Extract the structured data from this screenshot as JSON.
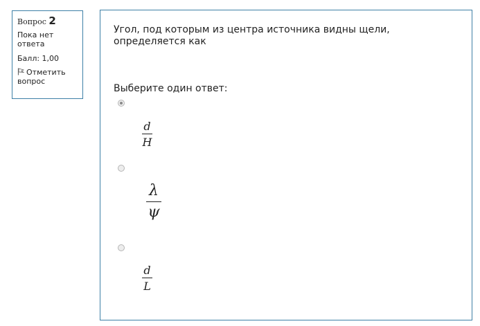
{
  "info": {
    "question_label": "Вопрос",
    "question_number": "2",
    "state": "Пока нет ответа",
    "grade": "Балл: 1,00",
    "flag_label": "Отметить вопрос"
  },
  "question": {
    "text": "Угол, под которым из центра источника видны щели, определяется как",
    "prompt": "Выберите один ответ:"
  },
  "answers": [
    {
      "numerator": "d",
      "denominator": "H",
      "selected": true
    },
    {
      "numerator": "λ",
      "denominator": "ψ",
      "selected": false
    },
    {
      "numerator": "d",
      "denominator": "L",
      "selected": false
    }
  ],
  "colors": {
    "border": "#3d7fa6"
  }
}
